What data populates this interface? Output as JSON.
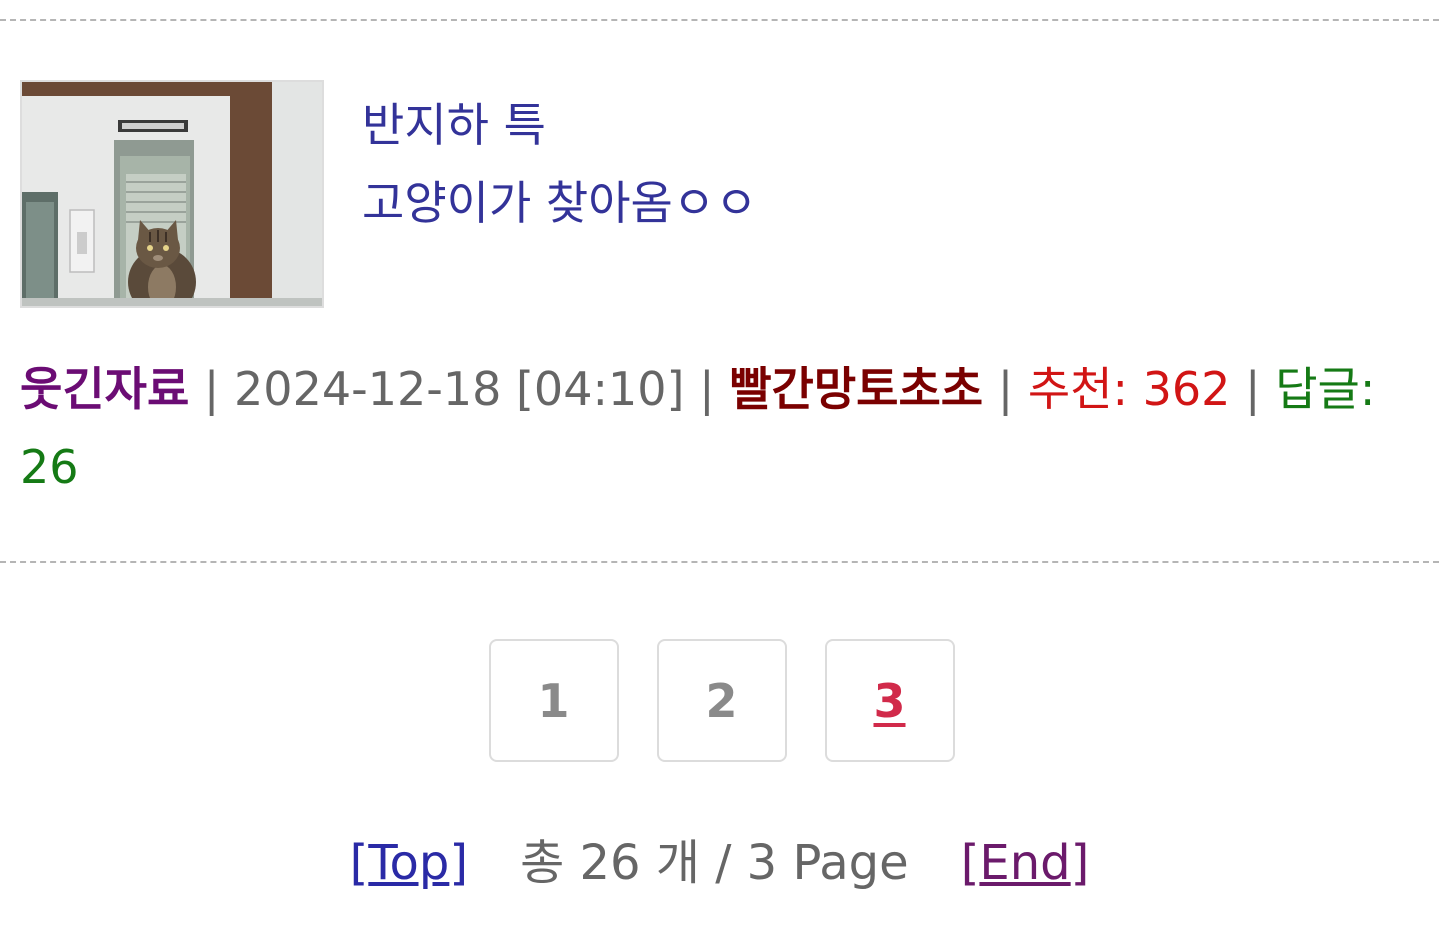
{
  "post": {
    "thumbnail": {
      "icon": "cat-photo-icon"
    },
    "title_lines": [
      "반지하 특",
      "고양이가 찾아옴ㅇㅇ"
    ],
    "meta": {
      "category": "웃긴자료",
      "separator": " | ",
      "datetime": "2024-12-18 [04:10]",
      "author": "빨간망토초초",
      "recommend_label": "추천: 362",
      "replies_label": "답글: 26"
    },
    "colors": {
      "title": "#333399",
      "category": "#6b0c74",
      "author": "#7a0000",
      "recommend": "#d11515",
      "replies": "#157a15"
    }
  },
  "pagination": {
    "pages": [
      "1",
      "2",
      "3"
    ],
    "current": "3",
    "current_color": "#d12a4a"
  },
  "footer_nav": {
    "top_open": "[",
    "top_label": "Top",
    "top_close": "]",
    "summary": "총 26 개 / 3 Page",
    "end_open": "[",
    "end_label": "End",
    "end_close": "]"
  }
}
